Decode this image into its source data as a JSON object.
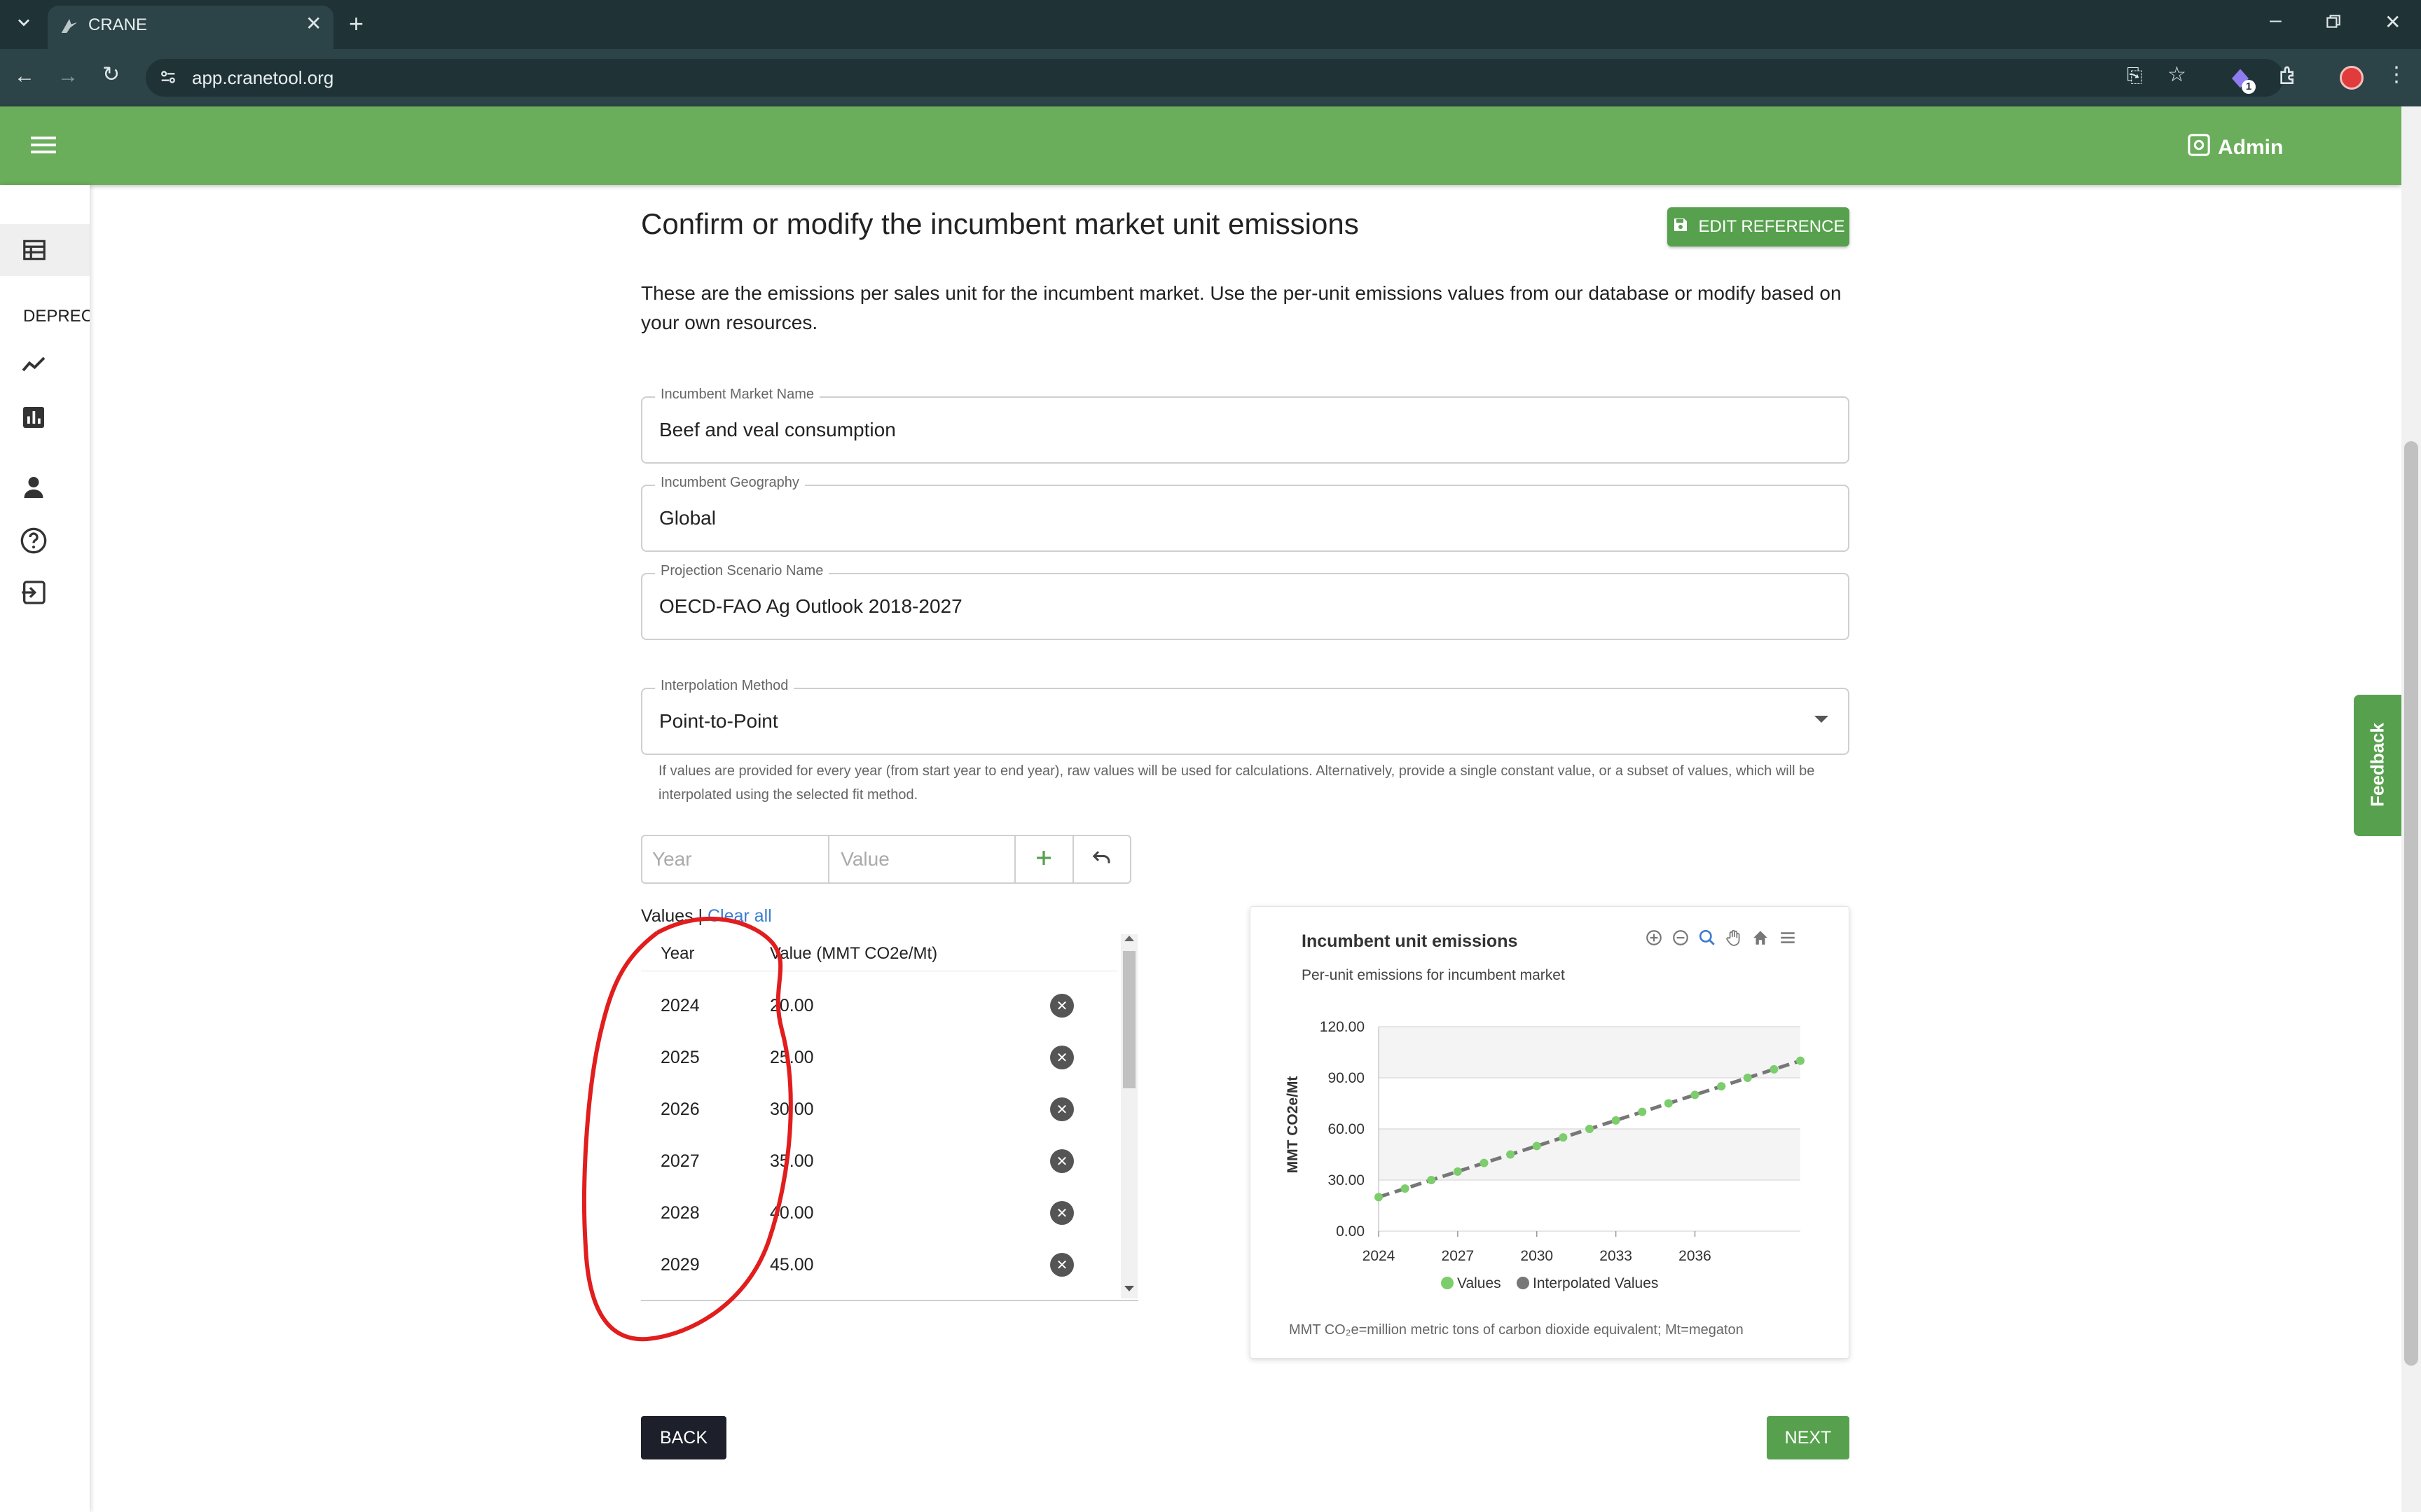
{
  "browser": {
    "tab_title": "CRANE",
    "url": "app.cranetool.org",
    "extension_badge": "1"
  },
  "appbar": {
    "admin_label": "Admin"
  },
  "sidebar": {
    "section_label": "DEPRECA"
  },
  "page": {
    "title": "Confirm or modify the incumbent market unit emissions",
    "edit_reference_label": "EDIT REFERENCE",
    "description": "These are the emissions per sales unit for the incumbent market. Use the per-unit emissions values from our database or modify based on your own resources."
  },
  "form": {
    "market_name": {
      "label": "Incumbent Market Name",
      "value": "Beef and veal consumption"
    },
    "geography": {
      "label": "Incumbent Geography",
      "value": "Global"
    },
    "scenario": {
      "label": "Projection Scenario Name",
      "value": "OECD-FAO Ag Outlook 2018-2027"
    },
    "interpolation": {
      "label": "Interpolation Method",
      "value": "Point-to-Point"
    },
    "helper": "If values are provided for every year (from start year to end year), raw values will be used for calculations. Alternatively, provide a single constant value, or a subset of values, which will be interpolated using the selected fit method.",
    "year_placeholder": "Year",
    "value_placeholder": "Value"
  },
  "values_table": {
    "label": "Values",
    "separator": "|",
    "clear_all": "Clear all",
    "headers": {
      "year": "Year",
      "value": "Value (MMT CO2e/Mt)"
    },
    "rows": [
      {
        "year": "2024",
        "value": "20.00"
      },
      {
        "year": "2025",
        "value": "25.00"
      },
      {
        "year": "2026",
        "value": "30.00"
      },
      {
        "year": "2027",
        "value": "35.00"
      },
      {
        "year": "2028",
        "value": "40.00"
      },
      {
        "year": "2029",
        "value": "45.00"
      }
    ]
  },
  "chart_card": {
    "footnote": "MMT CO₂e=million metric tons of carbon dioxide equivalent; Mt=megaton"
  },
  "chart_data": {
    "type": "line",
    "title": "Incumbent unit emissions",
    "subtitle": "Per-unit emissions for incumbent market",
    "ylabel": "MMT CO2e/Mt",
    "xlabel": "",
    "ylim": [
      0,
      120
    ],
    "xlim": [
      2024,
      2040
    ],
    "y_ticks": [
      "0.00",
      "30.00",
      "60.00",
      "90.00",
      "120.00"
    ],
    "x_ticks": [
      "2024",
      "2027",
      "2030",
      "2033",
      "2036"
    ],
    "legend": [
      "Values",
      "Interpolated Values"
    ],
    "legend_position": "bottom",
    "x": [
      2024,
      2025,
      2026,
      2027,
      2028,
      2029,
      2030,
      2031,
      2032,
      2033,
      2034,
      2035,
      2036,
      2037,
      2038,
      2039,
      2040
    ],
    "series": [
      {
        "name": "Values",
        "color": "#7ccd6b",
        "values": [
          20,
          25,
          30,
          35,
          40,
          45,
          50,
          55,
          60,
          65,
          70,
          75,
          80,
          85,
          90,
          95,
          100
        ]
      },
      {
        "name": "Interpolated Values",
        "color": "#777777",
        "values": [
          20,
          25,
          30,
          35,
          40,
          45,
          50,
          55,
          60,
          65,
          70,
          75,
          80,
          85,
          90,
          95,
          100
        ]
      }
    ]
  },
  "nav": {
    "back_label": "BACK",
    "next_label": "NEXT"
  },
  "feedback": {
    "label": "Feedback"
  }
}
